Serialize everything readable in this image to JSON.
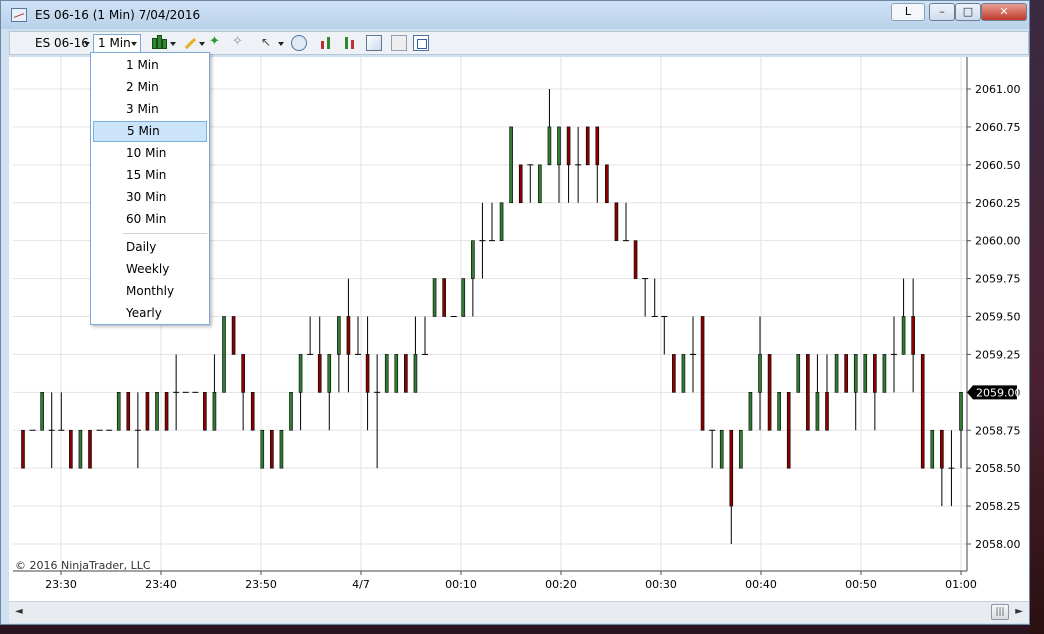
{
  "window": {
    "title": "ES 06-16 (1 Min)  7/04/2016",
    "btn_L": "L",
    "btn_min": "–",
    "btn_max": "□",
    "btn_close": "✕"
  },
  "toolbar": {
    "instrument": "ES 06-16",
    "period": "1 Min"
  },
  "period_menu": {
    "items": [
      "1 Min",
      "2 Min",
      "3 Min",
      "5 Min",
      "10 Min",
      "15 Min",
      "30 Min",
      "60 Min",
      "Daily",
      "Weekly",
      "Monthly",
      "Yearly"
    ],
    "selected": "5 Min"
  },
  "chart": {
    "copyright": "© 2016 NinjaTrader, LLC",
    "current_price": "2059.00"
  },
  "scrollbar": {
    "left_arrow": "◄",
    "right_arrow": "►",
    "thumb": "|||"
  },
  "chart_data": {
    "type": "ohlc",
    "up_color": "#2e7d32",
    "down_color": "#8b0000",
    "y_ticks": [
      "2061.00",
      "2060.75",
      "2060.50",
      "2060.25",
      "2060.00",
      "2059.75",
      "2059.50",
      "2059.25",
      "2059.00",
      "2058.75",
      "2058.50",
      "2058.25",
      "2058.00"
    ],
    "y_range": [
      2058.0,
      2061.0
    ],
    "x_ticks": [
      "23:30",
      "23:40",
      "23:50",
      "4/7",
      "00:10",
      "00:20",
      "00:30",
      "00:40",
      "00:50",
      "01:00"
    ],
    "bars": [
      [
        2058.75,
        2058.75,
        2058.5,
        2058.5
      ],
      [
        2058.75,
        2058.75,
        2058.75,
        2058.75
      ],
      [
        2058.75,
        2059.0,
        2058.75,
        2059.0
      ],
      [
        2058.75,
        2059.0,
        2058.5,
        2058.75
      ],
      [
        2058.75,
        2059.0,
        2058.75,
        2058.75
      ],
      [
        2058.75,
        2058.75,
        2058.5,
        2058.5
      ],
      [
        2058.5,
        2058.75,
        2058.5,
        2058.75
      ],
      [
        2058.75,
        2058.75,
        2058.5,
        2058.5
      ],
      [
        2058.75,
        2058.75,
        2058.75,
        2058.75
      ],
      [
        2058.75,
        2058.75,
        2058.75,
        2058.75
      ],
      [
        2058.75,
        2059.0,
        2058.75,
        2059.0
      ],
      [
        2059.0,
        2059.0,
        2058.75,
        2058.75
      ],
      [
        2058.75,
        2059.0,
        2058.5,
        2058.75
      ],
      [
        2059.0,
        2059.0,
        2058.75,
        2058.75
      ],
      [
        2058.75,
        2059.0,
        2058.75,
        2059.0
      ],
      [
        2059.0,
        2059.0,
        2058.75,
        2058.75
      ],
      [
        2059.0,
        2059.25,
        2058.75,
        2059.0
      ],
      [
        2059.0,
        2059.0,
        2059.0,
        2059.0
      ],
      [
        2059.0,
        2059.0,
        2059.0,
        2059.0
      ],
      [
        2059.0,
        2059.0,
        2058.75,
        2058.75
      ],
      [
        2058.75,
        2059.25,
        2058.75,
        2059.0
      ],
      [
        2059.0,
        2059.5,
        2059.0,
        2059.5
      ],
      [
        2059.5,
        2059.5,
        2059.25,
        2059.25
      ],
      [
        2059.25,
        2059.25,
        2058.75,
        2059.0
      ],
      [
        2059.0,
        2059.0,
        2058.75,
        2058.75
      ],
      [
        2058.5,
        2058.75,
        2058.5,
        2058.75
      ],
      [
        2058.75,
        2058.75,
        2058.5,
        2058.5
      ],
      [
        2058.5,
        2058.75,
        2058.5,
        2058.75
      ],
      [
        2058.75,
        2059.0,
        2058.75,
        2059.0
      ],
      [
        2059.0,
        2059.25,
        2058.75,
        2059.25
      ],
      [
        2059.25,
        2059.5,
        2059.25,
        2059.25
      ],
      [
        2059.25,
        2059.5,
        2059.0,
        2059.0
      ],
      [
        2059.0,
        2059.25,
        2058.75,
        2059.25
      ],
      [
        2059.25,
        2059.5,
        2059.0,
        2059.5
      ],
      [
        2059.5,
        2059.75,
        2059.0,
        2059.25
      ],
      [
        2059.25,
        2059.5,
        2059.25,
        2059.25
      ],
      [
        2059.25,
        2059.5,
        2058.75,
        2059.0
      ],
      [
        2059.0,
        2059.25,
        2058.5,
        2059.0
      ],
      [
        2059.0,
        2059.25,
        2059.0,
        2059.25
      ],
      [
        2059.0,
        2059.25,
        2059.0,
        2059.25
      ],
      [
        2059.25,
        2059.25,
        2059.0,
        2059.0
      ],
      [
        2059.0,
        2059.5,
        2059.0,
        2059.25
      ],
      [
        2059.25,
        2059.5,
        2059.25,
        2059.25
      ],
      [
        2059.5,
        2059.75,
        2059.5,
        2059.75
      ],
      [
        2059.75,
        2059.75,
        2059.5,
        2059.5
      ],
      [
        2059.5,
        2059.5,
        2059.5,
        2059.5
      ],
      [
        2059.5,
        2059.75,
        2059.5,
        2059.75
      ],
      [
        2059.75,
        2060.0,
        2059.5,
        2060.0
      ],
      [
        2060.0,
        2060.25,
        2059.75,
        2060.0
      ],
      [
        2060.0,
        2060.25,
        2060.0,
        2060.0
      ],
      [
        2060.0,
        2060.25,
        2060.0,
        2060.25
      ],
      [
        2060.25,
        2060.75,
        2060.25,
        2060.75
      ],
      [
        2060.5,
        2060.5,
        2060.25,
        2060.25
      ],
      [
        2060.5,
        2060.5,
        2060.25,
        2060.5
      ],
      [
        2060.25,
        2060.5,
        2060.25,
        2060.5
      ],
      [
        2060.5,
        2061.0,
        2060.5,
        2060.75
      ],
      [
        2060.5,
        2060.75,
        2060.25,
        2060.75
      ],
      [
        2060.75,
        2060.75,
        2060.25,
        2060.5
      ],
      [
        2060.5,
        2060.75,
        2060.25,
        2060.5
      ],
      [
        2060.75,
        2060.75,
        2060.5,
        2060.5
      ],
      [
        2060.75,
        2060.75,
        2060.25,
        2060.5
      ],
      [
        2060.5,
        2060.5,
        2060.25,
        2060.25
      ],
      [
        2060.25,
        2060.25,
        2060.0,
        2060.0
      ],
      [
        2060.0,
        2060.25,
        2060.0,
        2060.0
      ],
      [
        2060.0,
        2060.0,
        2059.75,
        2059.75
      ],
      [
        2059.75,
        2059.75,
        2059.5,
        2059.75
      ],
      [
        2059.5,
        2059.75,
        2059.5,
        2059.5
      ],
      [
        2059.5,
        2059.5,
        2059.25,
        2059.5
      ],
      [
        2059.25,
        2059.25,
        2059.0,
        2059.0
      ],
      [
        2059.0,
        2059.25,
        2059.0,
        2059.25
      ],
      [
        2059.25,
        2059.5,
        2059.0,
        2059.25
      ],
      [
        2059.5,
        2059.5,
        2058.75,
        2058.75
      ],
      [
        2058.75,
        2058.75,
        2058.5,
        2058.75
      ],
      [
        2058.5,
        2058.75,
        2058.5,
        2058.75
      ],
      [
        2058.75,
        2058.75,
        2058.0,
        2058.25
      ],
      [
        2058.5,
        2058.75,
        2058.5,
        2058.75
      ],
      [
        2058.75,
        2059.0,
        2058.75,
        2059.0
      ],
      [
        2059.0,
        2059.5,
        2058.75,
        2059.25
      ],
      [
        2059.25,
        2059.25,
        2058.75,
        2058.75
      ],
      [
        2058.75,
        2059.0,
        2058.75,
        2059.0
      ],
      [
        2059.0,
        2059.0,
        2058.5,
        2058.5
      ],
      [
        2059.0,
        2059.25,
        2059.0,
        2059.25
      ],
      [
        2059.25,
        2059.25,
        2058.75,
        2058.75
      ],
      [
        2058.75,
        2059.25,
        2058.75,
        2059.0
      ],
      [
        2059.0,
        2059.25,
        2058.75,
        2058.75
      ],
      [
        2059.0,
        2059.25,
        2059.0,
        2059.25
      ],
      [
        2059.25,
        2059.25,
        2059.0,
        2059.0
      ],
      [
        2059.0,
        2059.25,
        2058.75,
        2059.25
      ],
      [
        2059.0,
        2059.25,
        2059.0,
        2059.25
      ],
      [
        2059.25,
        2059.25,
        2058.75,
        2059.0
      ],
      [
        2059.0,
        2059.25,
        2059.0,
        2059.25
      ],
      [
        2059.25,
        2059.5,
        2059.0,
        2059.25
      ],
      [
        2059.25,
        2059.75,
        2059.25,
        2059.5
      ],
      [
        2059.5,
        2059.75,
        2059.0,
        2059.25
      ],
      [
        2059.25,
        2059.25,
        2058.5,
        2058.5
      ],
      [
        2058.5,
        2058.75,
        2058.5,
        2058.75
      ],
      [
        2058.75,
        2058.75,
        2058.25,
        2058.5
      ],
      [
        2058.5,
        2058.75,
        2058.25,
        2058.5
      ],
      [
        2058.75,
        2059.0,
        2058.5,
        2059.0
      ]
    ]
  }
}
